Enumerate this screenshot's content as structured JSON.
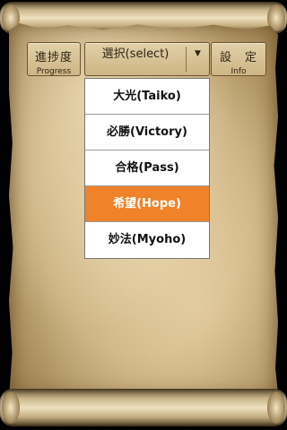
{
  "nav": {
    "progress": {
      "main": "進捗度",
      "sub": "Progress"
    },
    "info": {
      "main": "設　定",
      "sub": "Info"
    }
  },
  "select": {
    "label": "選択(select)",
    "arrow_icon": "triangle-down-icon"
  },
  "options": [
    {
      "label": "大光(Taiko)",
      "selected": false
    },
    {
      "label": "必勝(Victory)",
      "selected": false
    },
    {
      "label": "合格(Pass)",
      "selected": false
    },
    {
      "label": "希望(Hope)",
      "selected": true
    },
    {
      "label": "妙法(Myoho)",
      "selected": false
    }
  ],
  "colors": {
    "selected_option": "#f0822a",
    "paper": "#c7ad7c",
    "background": "#000000"
  }
}
